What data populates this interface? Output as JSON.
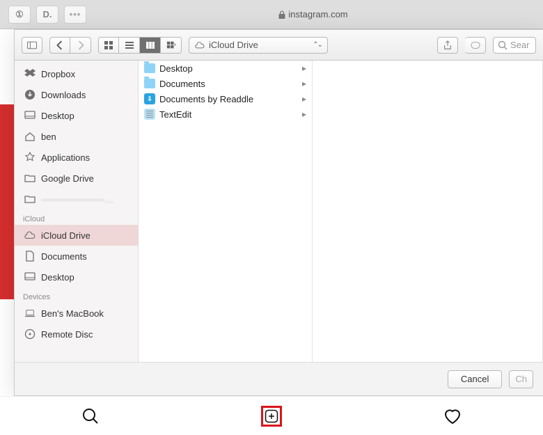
{
  "browser": {
    "ext1": "①",
    "ext2": "D.",
    "domain": "instagram.com"
  },
  "toolbar": {
    "path_label": "iCloud Drive",
    "search_placeholder": "Sear"
  },
  "sidebar": {
    "favorites": [
      {
        "label": "Dropbox",
        "icon": "dropbox"
      },
      {
        "label": "Downloads",
        "icon": "downloads"
      },
      {
        "label": "Desktop",
        "icon": "desktop"
      },
      {
        "label": "ben",
        "icon": "home"
      },
      {
        "label": "Applications",
        "icon": "apps"
      },
      {
        "label": "Google Drive",
        "icon": "folder"
      },
      {
        "label": "———————…",
        "icon": "folder"
      }
    ],
    "icloud_header": "iCloud",
    "icloud": [
      {
        "label": "iCloud Drive",
        "icon": "cloud",
        "selected": true
      },
      {
        "label": "Documents",
        "icon": "doc"
      },
      {
        "label": "Desktop",
        "icon": "desktop"
      }
    ],
    "devices_header": "Devices",
    "devices": [
      {
        "label": "Ben's MacBook",
        "icon": "laptop"
      },
      {
        "label": "Remote Disc",
        "icon": "disc"
      }
    ]
  },
  "column1": [
    {
      "label": "Desktop",
      "kind": "folder"
    },
    {
      "label": "Documents",
      "kind": "folder"
    },
    {
      "label": "Documents by Readdle",
      "kind": "readdle"
    },
    {
      "label": "TextEdit",
      "kind": "textedit"
    }
  ],
  "footer": {
    "cancel": "Cancel",
    "choose": "Ch"
  }
}
